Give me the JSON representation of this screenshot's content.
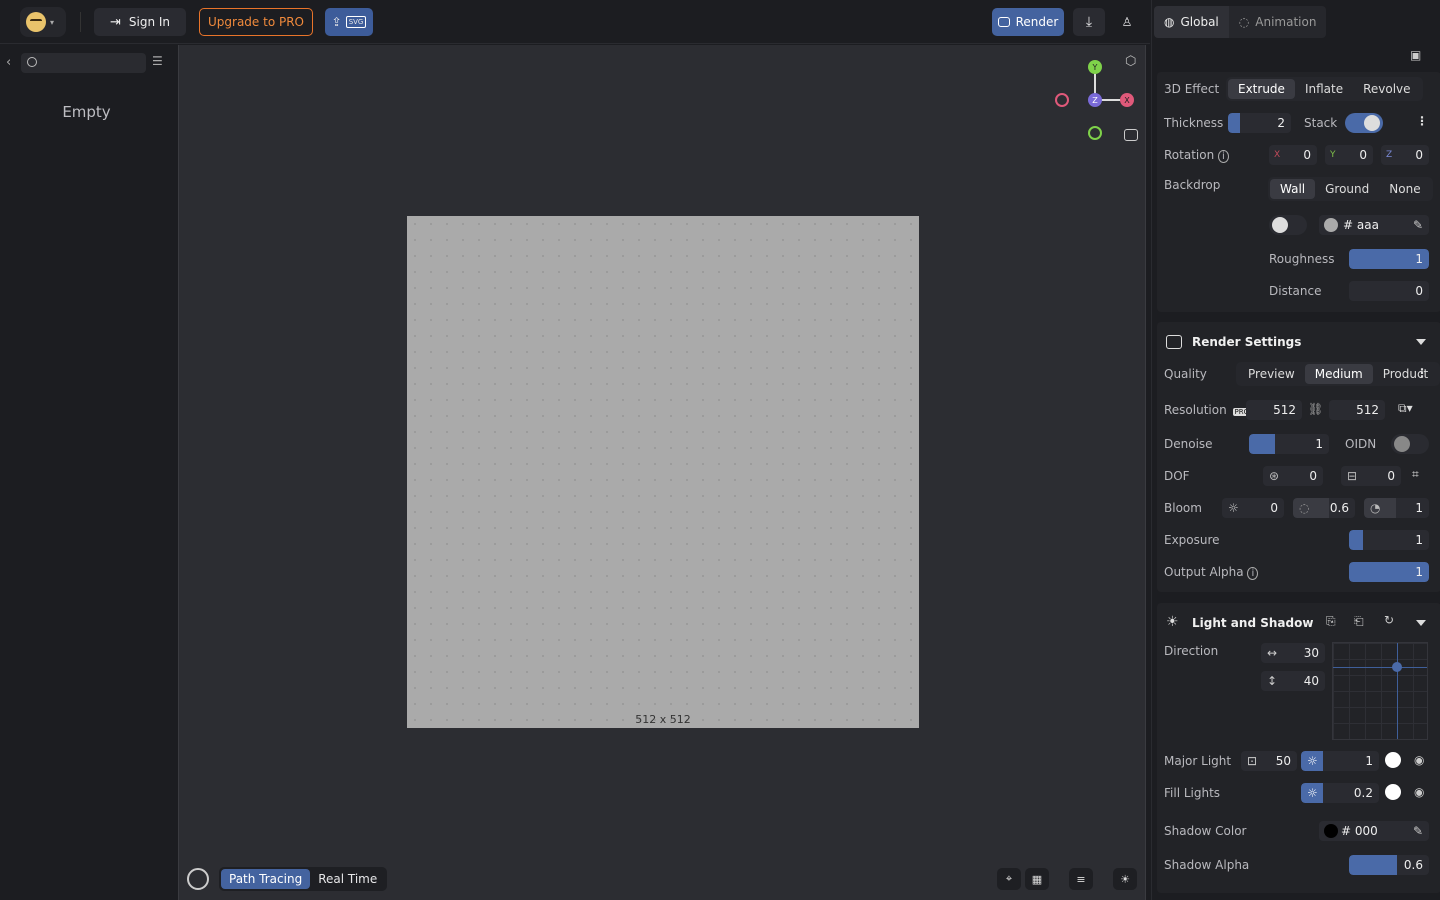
{
  "toolbar": {
    "sign_in": "Sign In",
    "upgrade": "Upgrade to PRO",
    "export_svg": "SVG",
    "render": "Render"
  },
  "left_panel": {
    "empty": "Empty"
  },
  "viewport": {
    "canvas_size": "512 x 512",
    "canvas_color": "#aaaaaa",
    "gizmo": {
      "y": "Y",
      "x": "X",
      "z": "Z"
    },
    "modes": [
      "Path Tracing",
      "Real Time"
    ],
    "active_mode": "Path Tracing"
  },
  "tabs": [
    "Global",
    "Animation"
  ],
  "effect": {
    "label": "3D Effect",
    "options": [
      "Extrude",
      "Inflate",
      "Revolve"
    ],
    "thickness_label": "Thickness",
    "thickness": "2",
    "stack_label": "Stack",
    "rotation_label": "Rotation",
    "rotation": {
      "x_label": "X",
      "x": "0",
      "y_label": "Y",
      "y": "0",
      "z_label": "Z",
      "z": "0"
    },
    "backdrop_label": "Backdrop",
    "backdrop_options": [
      "Wall",
      "Ground",
      "None"
    ],
    "backdrop_color": "# aaa",
    "roughness_label": "Roughness",
    "roughness": "1",
    "distance_label": "Distance",
    "distance": "0"
  },
  "render_settings": {
    "title": "Render Settings",
    "quality_label": "Quality",
    "quality_options": [
      "Preview",
      "Medium",
      "Product"
    ],
    "resolution_label": "Resolution",
    "pro_badge": "PRO",
    "res_w": "512",
    "res_h": "512",
    "denoise_label": "Denoise",
    "denoise": "1",
    "oidn_label": "OIDN",
    "dof_label": "DOF",
    "dof_a": "0",
    "dof_b": "0",
    "bloom_label": "Bloom",
    "bloom_a": "0",
    "bloom_b": "0.6",
    "bloom_c": "1",
    "exposure_label": "Exposure",
    "exposure": "1",
    "alpha_label": "Output Alpha",
    "alpha": "1"
  },
  "light": {
    "title": "Light and Shadow",
    "direction_label": "Direction",
    "dir_h": "30",
    "dir_v": "40",
    "major_label": "Major Light",
    "major_size": "50",
    "major_int": "1",
    "fill_label": "Fill Lights",
    "fill_int": "0.2",
    "shadow_color_label": "Shadow Color",
    "shadow_color": "# 000",
    "shadow_alpha_label": "Shadow Alpha",
    "shadow_alpha": "0.6"
  }
}
